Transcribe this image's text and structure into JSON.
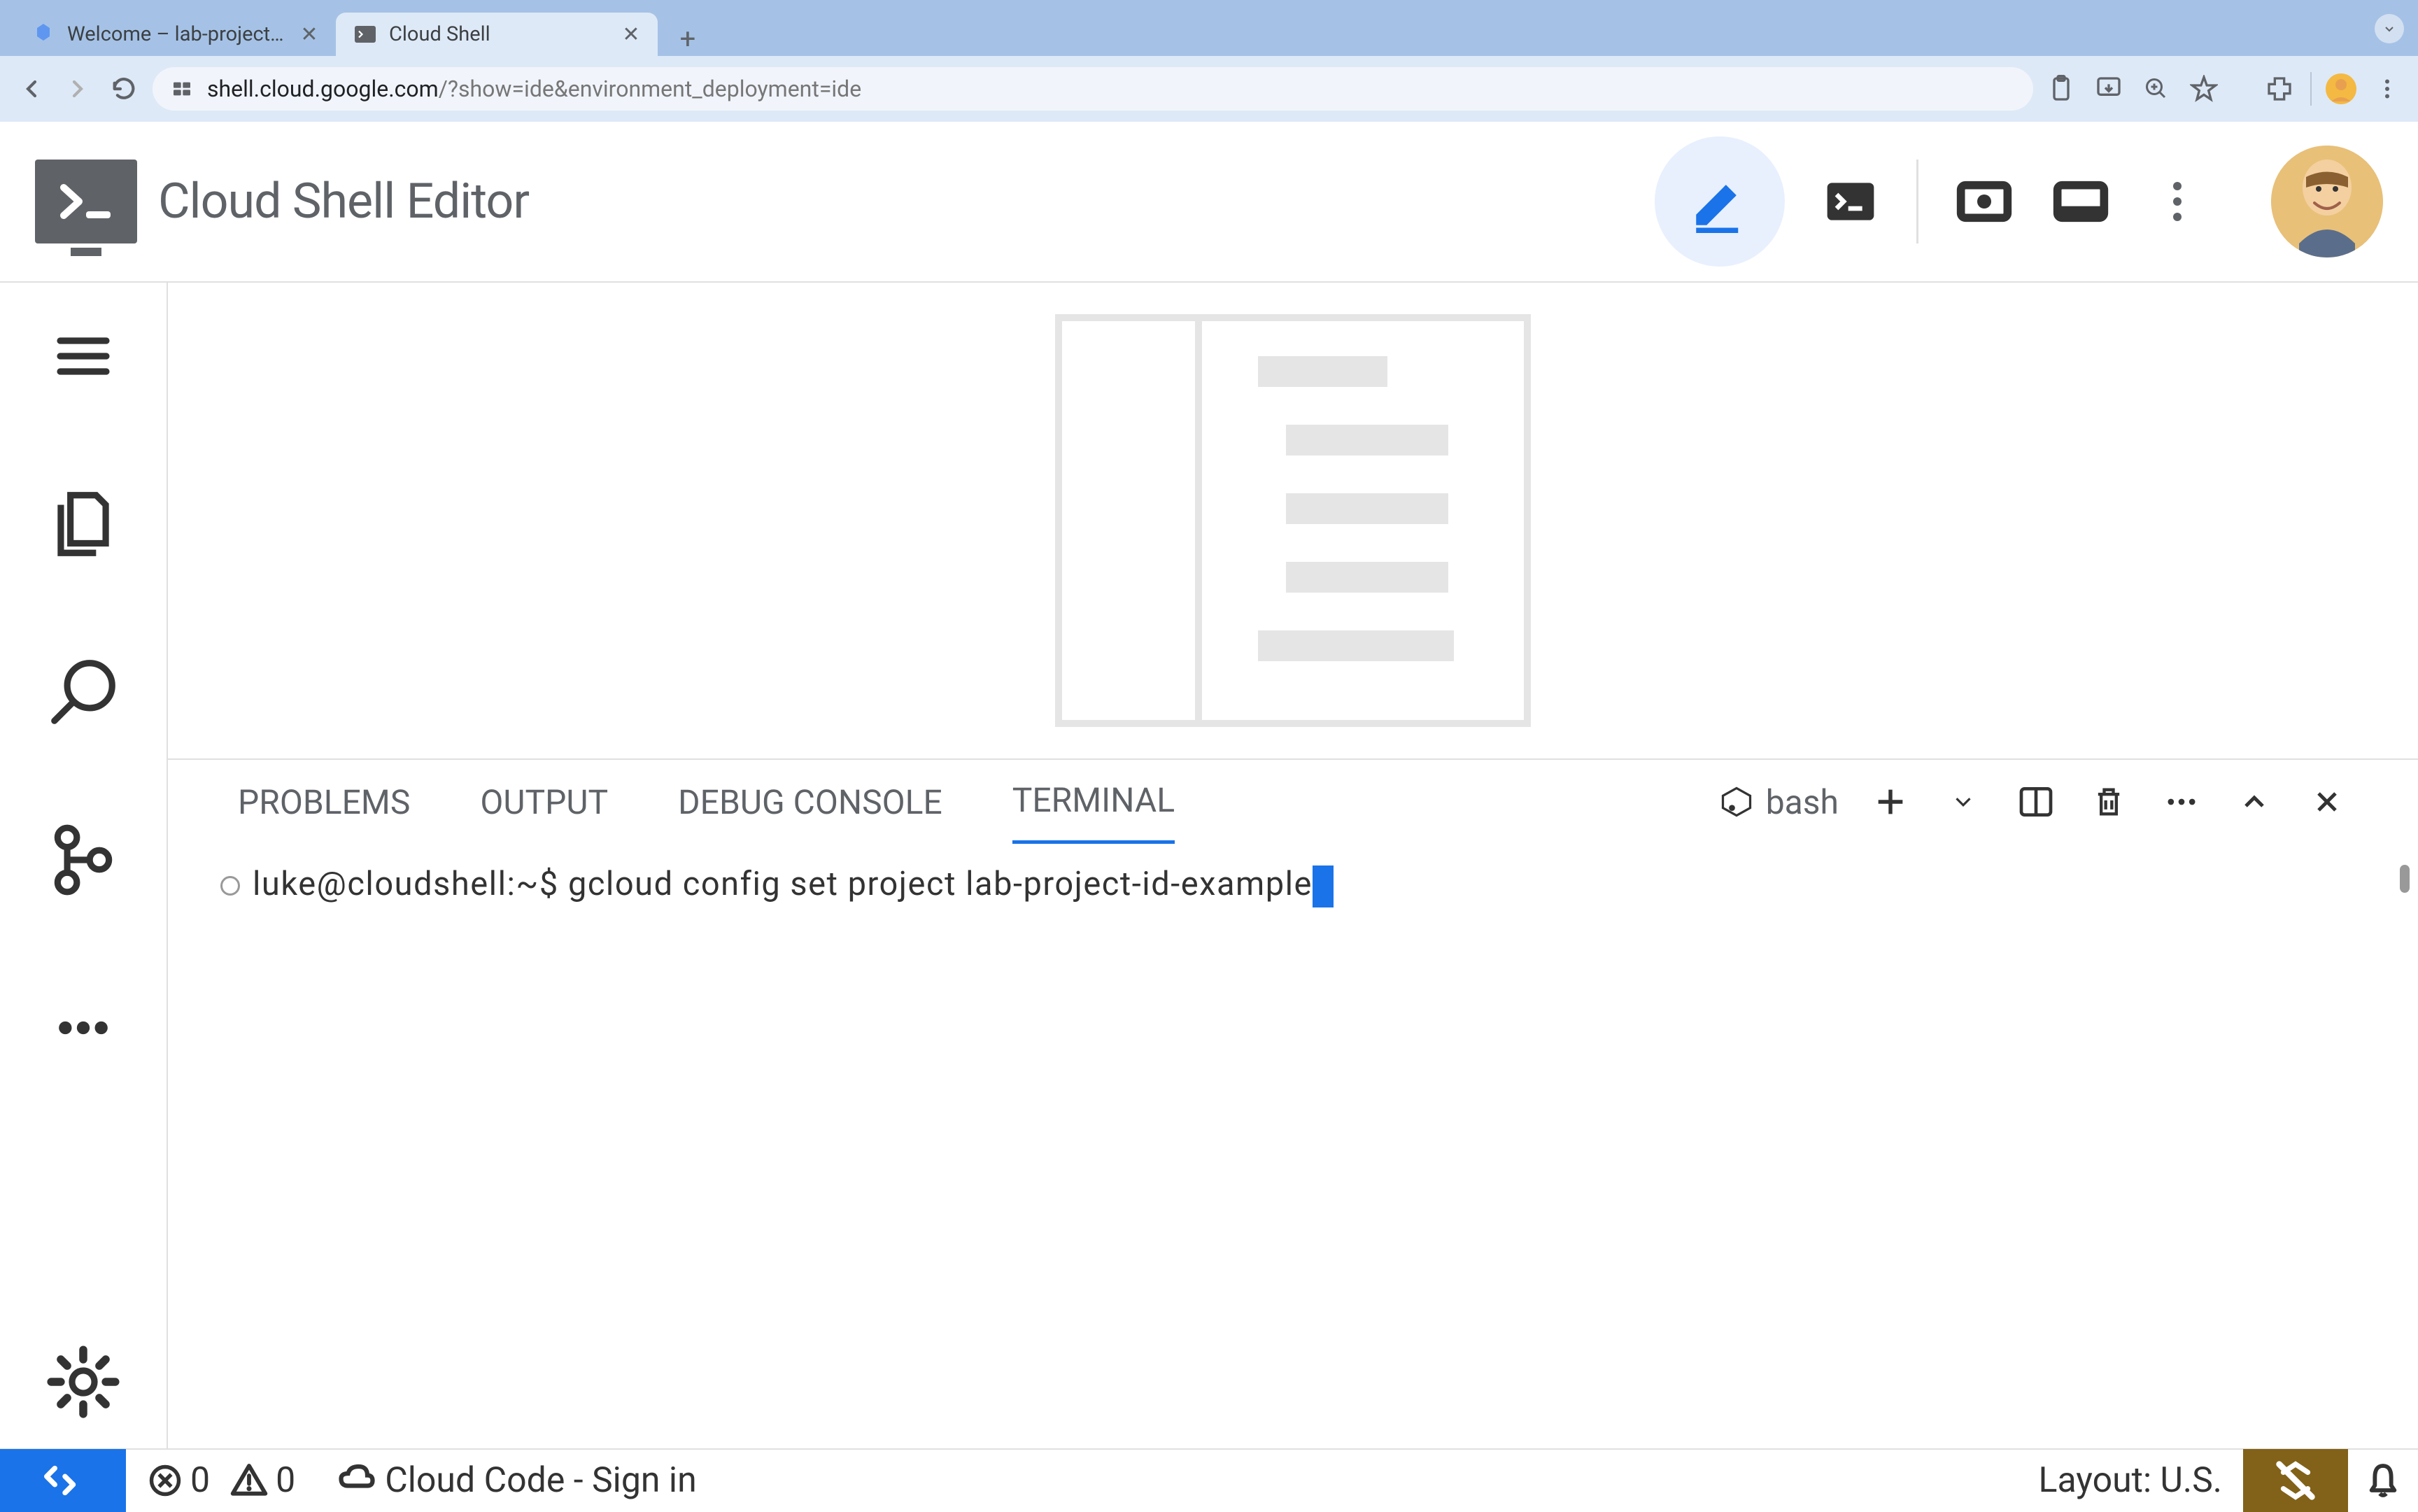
{
  "browser": {
    "tabs": [
      {
        "title": "Welcome – lab-project-id-ex",
        "active": false
      },
      {
        "title": "Cloud Shell",
        "active": true
      }
    ],
    "url": {
      "domain": "shell.cloud.google.com",
      "path": "/?show=ide&environment_deployment=ide"
    }
  },
  "header": {
    "title": "Cloud Shell Editor"
  },
  "terminal": {
    "tabs": [
      "PROBLEMS",
      "OUTPUT",
      "DEBUG CONSOLE",
      "TERMINAL"
    ],
    "active_tab": "TERMINAL",
    "shell_label": "bash",
    "prompt": "luke@cloudshell:~$ ",
    "command": "gcloud config set project lab-project-id-example"
  },
  "status_bar": {
    "errors": "0",
    "warnings": "0",
    "cloud_code": "Cloud Code - Sign in",
    "layout": "Layout: U.S."
  }
}
